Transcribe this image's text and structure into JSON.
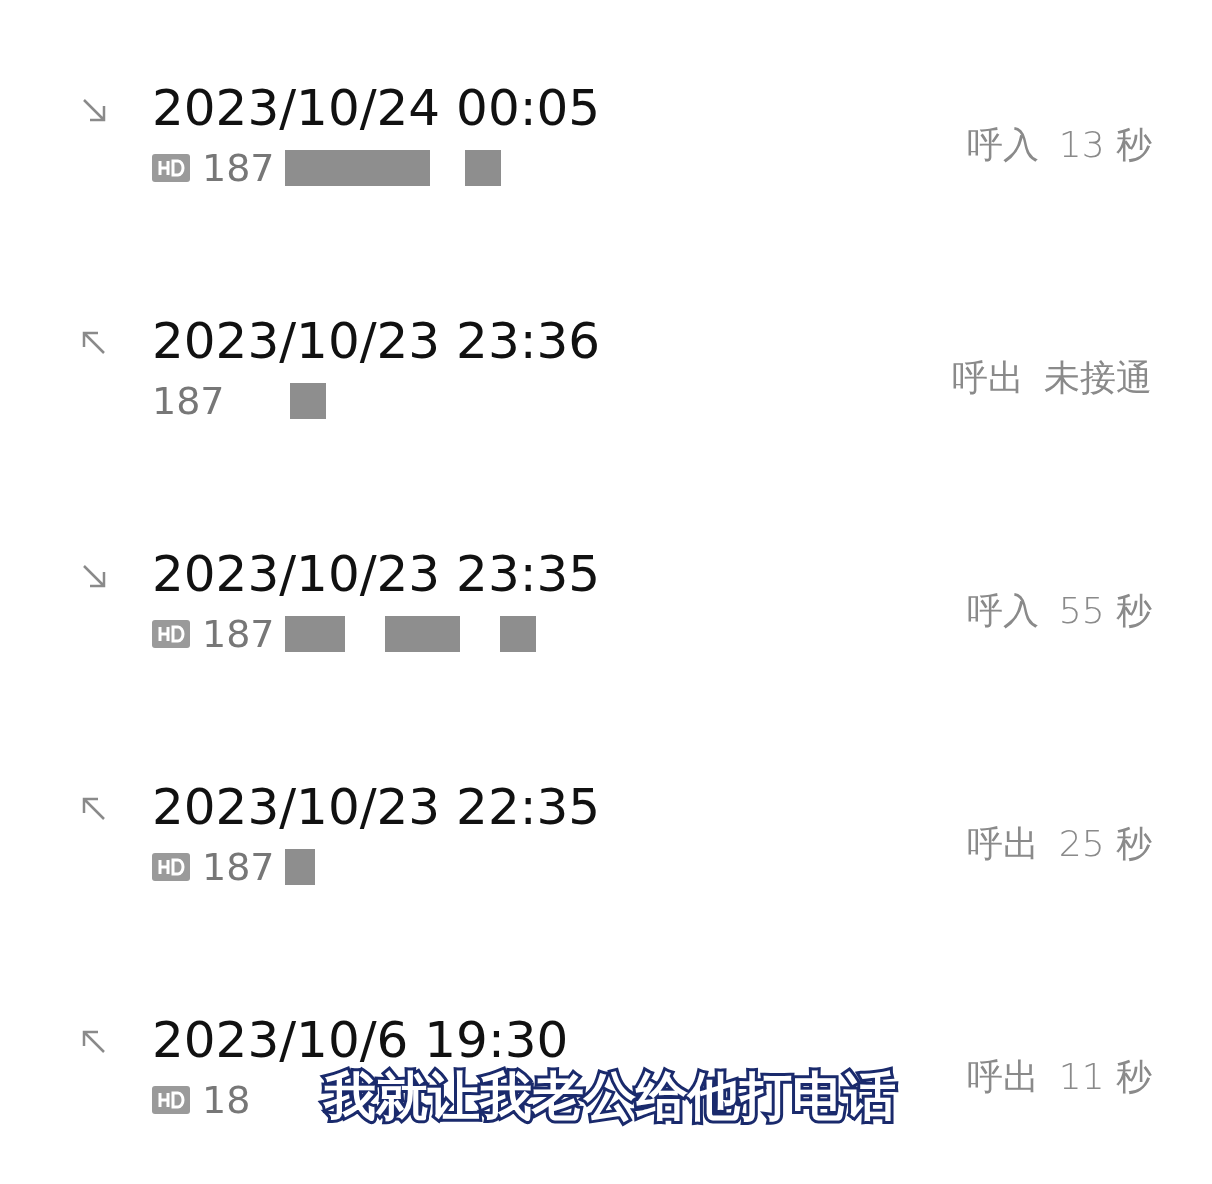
{
  "calls": [
    {
      "kind": "incoming",
      "time": "2023/10/24 00:05",
      "hd": true,
      "number": "187",
      "call_type": "呼入",
      "duration": "13 秒"
    },
    {
      "kind": "outgoing",
      "time": "2023/10/23 23:36",
      "hd": false,
      "number": "187",
      "call_type": "呼出",
      "duration": "未接通"
    },
    {
      "kind": "incoming",
      "time": "2023/10/23 23:35",
      "hd": true,
      "number": "187",
      "call_type": "呼入",
      "duration": "55 秒"
    },
    {
      "kind": "outgoing",
      "time": "2023/10/23 22:35",
      "hd": true,
      "number": "187",
      "call_type": "呼出",
      "duration": "25 秒"
    },
    {
      "kind": "outgoing",
      "time": "2023/10/6 19:30",
      "hd": true,
      "number": "18",
      "call_type": "呼出",
      "duration": "11 秒"
    }
  ],
  "subtitle": "我就让我老公给他打电话"
}
